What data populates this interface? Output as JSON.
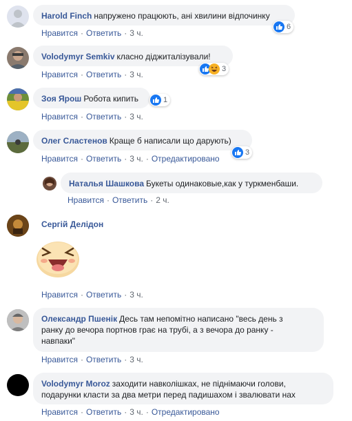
{
  "actions": {
    "like": "Нравится",
    "reply": "Ответить",
    "edited": "Отредактировано"
  },
  "comments": [
    {
      "author": "Harold Finch",
      "text": "напружено працюють, ані хвилини відпочинку",
      "time": "3 ч.",
      "reactions": "6"
    },
    {
      "author": "Volodymyr Semkiv",
      "text": "класно діджиталізували!",
      "time": "3 ч.",
      "reactions": "3"
    },
    {
      "author": "Зоя Ярош",
      "text": "Робота кипить",
      "time": "3 ч.",
      "reactions": "1"
    },
    {
      "author": "Олег Сластенов",
      "text": "Краще б написали що дарують)",
      "time": "3 ч.",
      "reactions": "3"
    },
    {
      "author": "Наталья Шашкова",
      "text": "Букеты одинаковые,как у туркменбаши.",
      "time": "2 ч."
    },
    {
      "author": "Сергій Делідон",
      "time": "3 ч."
    },
    {
      "author": "Олександр Пшенік",
      "text_line1": "Десь там непомітно написано \"весь день з",
      "text_line2": "ранку до вечора портнов грає на трубі, а з вечора до ранку -",
      "text_line3": "навпаки\"",
      "time": "3 ч."
    },
    {
      "author": "Volodymyr Moroz",
      "text_line1": "заходити навколішках, не піднімаючи голови,",
      "text_line2": "подарунки класти за два метри перед падишахом і звалювати нах",
      "time": "3 ч."
    }
  ],
  "colors": {
    "link": "#385898",
    "bubble": "#f2f3f5",
    "meta": "#606770",
    "like_blue": "#1877f2"
  }
}
